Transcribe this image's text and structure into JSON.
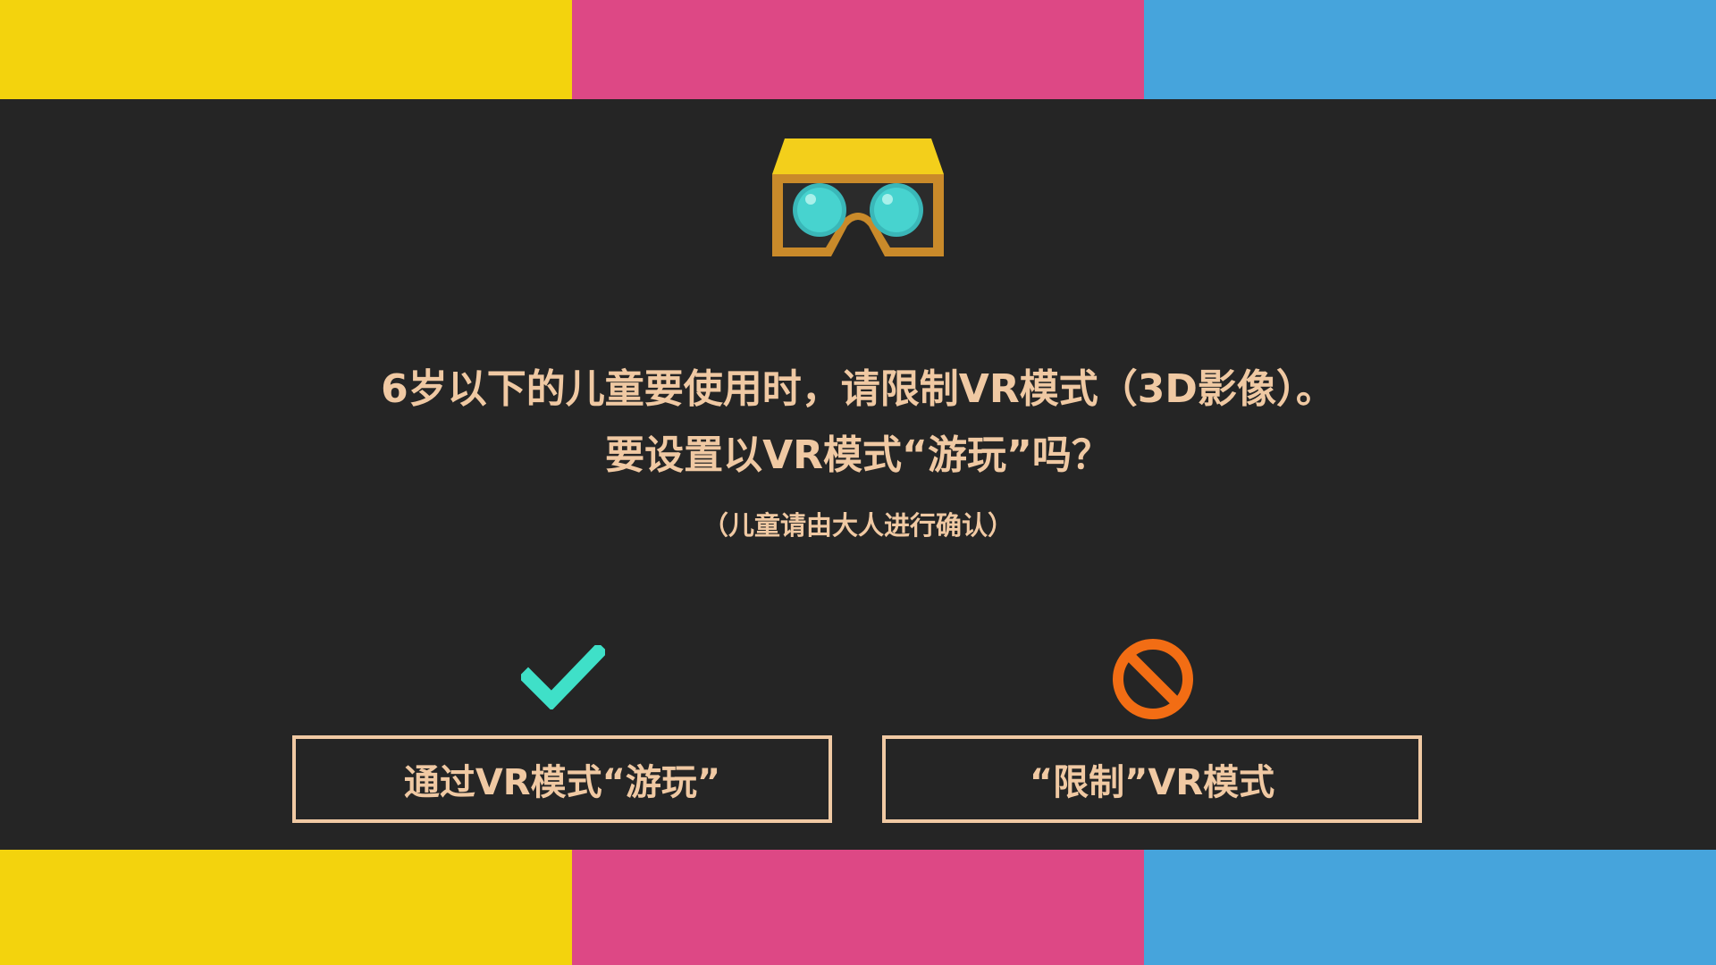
{
  "colors": {
    "background": "#252525",
    "text": "#f0c9a3",
    "yellow": "#f3d30d",
    "pink": "#dd4885",
    "blue": "#46a4dc",
    "check": "#3fe0c8",
    "prohibit": "#f26d14"
  },
  "header_icon": "vr-headset-icon",
  "message": {
    "line1": "6岁以下的儿童要使用时，请限制VR模式（3D影像）。",
    "line2": "要设置以VR模式“游玩”吗？",
    "note": "（儿童请由大人进行确认）"
  },
  "options": {
    "play": {
      "icon": "checkmark-icon",
      "label": "通过VR模式“游玩”"
    },
    "restrict": {
      "icon": "prohibit-icon",
      "label": "“限制”VR模式"
    }
  }
}
